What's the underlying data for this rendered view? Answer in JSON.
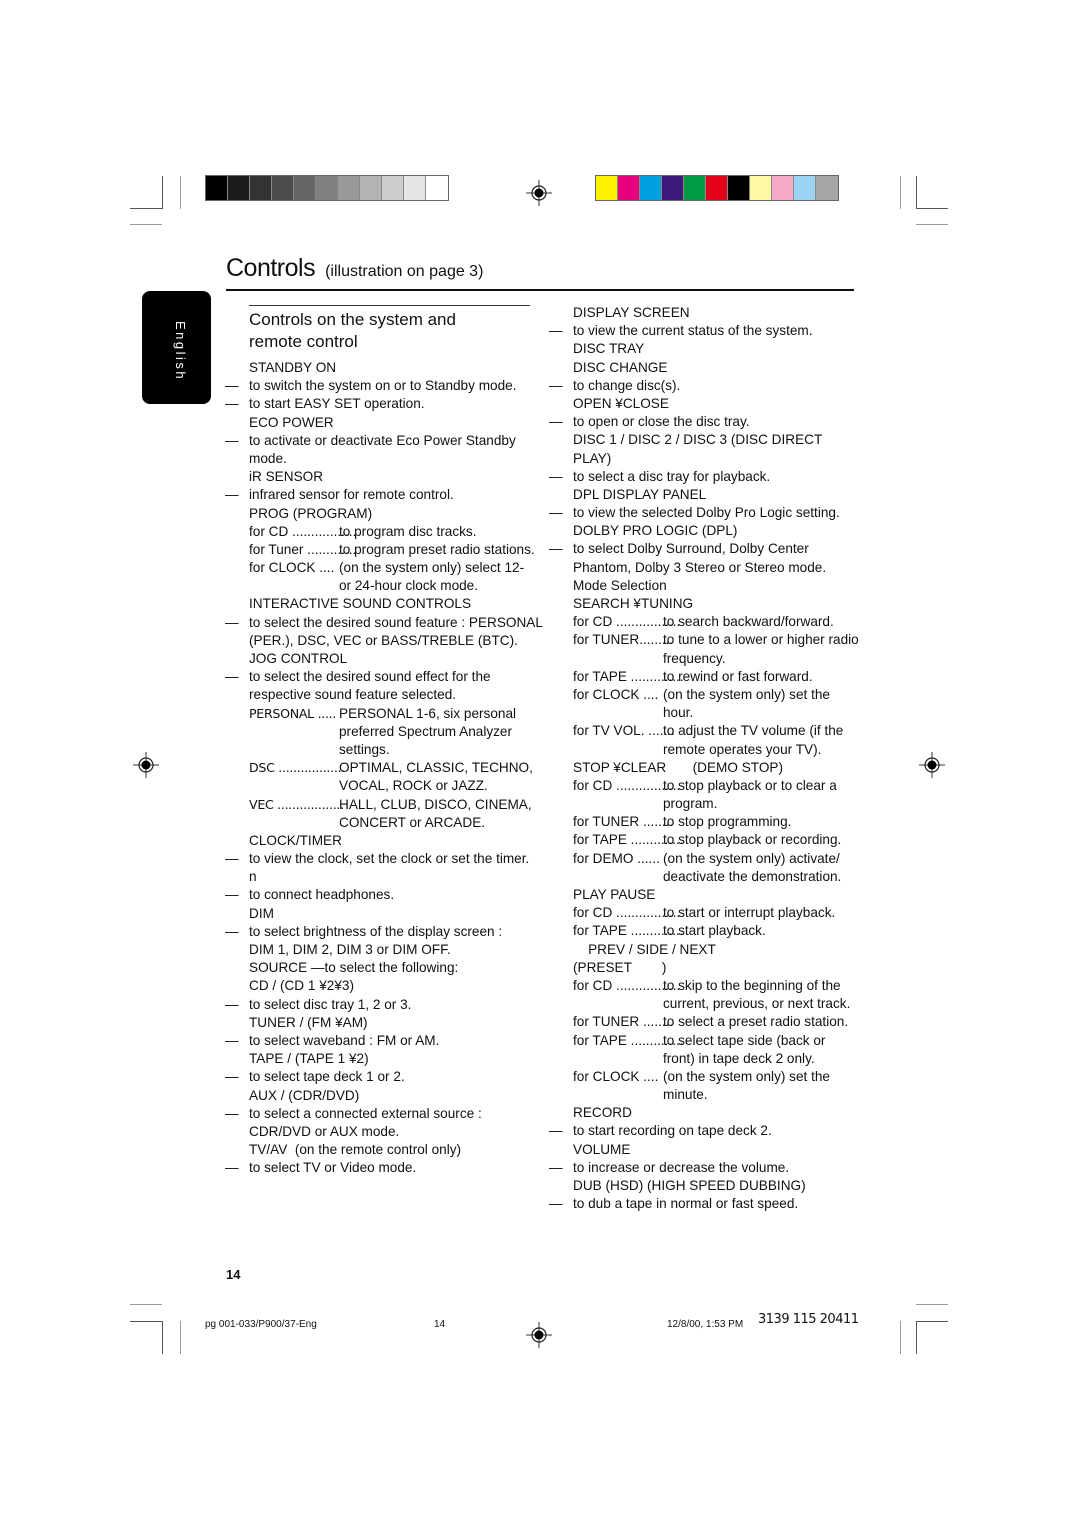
{
  "print_marks": {
    "gray_swatches": [
      "#000000",
      "#1c1c1c",
      "#333333",
      "#4d4d4d",
      "#666666",
      "#808080",
      "#999999",
      "#b3b3b3",
      "#cccccc",
      "#e6e6e6",
      "#ffffff"
    ],
    "color_swatches": [
      "#fff200",
      "#e6007e",
      "#00a0e3",
      "#3d1a7a",
      "#009a44",
      "#e2001a",
      "#000000",
      "#fff9a6",
      "#f5a9c8",
      "#9cd3f3",
      "#a6a6a6"
    ]
  },
  "header": {
    "title": "Controls",
    "subtitle": "(illustration on page 3)"
  },
  "language_tab": "English",
  "section": {
    "title_line1": "Controls on the system and",
    "title_line2": "remote control"
  },
  "left_column": [
    {
      "type": "heading",
      "text": "STANDBY ON"
    },
    {
      "type": "dash",
      "text": "to switch the system on or to Standby mode."
    },
    {
      "type": "dash",
      "text": "to start EASY SET operation."
    },
    {
      "type": "heading",
      "text": "ECO POWER"
    },
    {
      "type": "dash",
      "text": "to activate or deactivate Eco Power Standby"
    },
    {
      "type": "text",
      "text": "mode."
    },
    {
      "type": "heading",
      "text": "iR SENSOR"
    },
    {
      "type": "dash",
      "text": "infrared sensor for remote control."
    },
    {
      "type": "heading",
      "text": "PROG (PROGRAM)"
    },
    {
      "type": "item",
      "label": "for CD .................",
      "desc": "to program disc tracks."
    },
    {
      "type": "item",
      "label": "for Tuner .............",
      "desc": "to program preset radio stations."
    },
    {
      "type": "item",
      "label": "for CLOCK ....",
      "desc": "(on the system only) select 12-"
    },
    {
      "type": "cont",
      "text": "or 24-hour clock mode."
    },
    {
      "type": "heading",
      "text": "INTERACTIVE SOUND CONTROLS"
    },
    {
      "type": "dash",
      "text": "to select the desired sound feature : PERSONAL"
    },
    {
      "type": "text",
      "text": "(PER.), DSC, VEC or BASS/TREBLE (BTC)."
    },
    {
      "type": "heading",
      "text": "JOG CONTROL"
    },
    {
      "type": "dash",
      "text": "to select the desired sound effect for the"
    },
    {
      "type": "text",
      "text": "respective sound feature selected."
    },
    {
      "type": "item2",
      "label": "PERSONAL .....",
      "desc": "PERSONAL 1-6, six personal"
    },
    {
      "type": "cont",
      "text": "preferred Spectrum Analyzer"
    },
    {
      "type": "cont",
      "text": "settings."
    },
    {
      "type": "item2",
      "label": "DSC ..................",
      "desc": "OPTIMAL, CLASSIC, TECHNO,"
    },
    {
      "type": "cont",
      "text": "VOCAL, ROCK or JAZZ."
    },
    {
      "type": "item2",
      "label": "VEC ..................",
      "desc": "HALL, CLUB, DISCO, CINEMA,"
    },
    {
      "type": "cont",
      "text": "CONCERT or ARCADE."
    },
    {
      "type": "heading",
      "text": "CLOCK/TIMER"
    },
    {
      "type": "dash",
      "text": "to view the clock, set the clock or set the timer."
    },
    {
      "type": "text",
      "text": "n"
    },
    {
      "type": "dash",
      "text": "to connect headphones."
    },
    {
      "type": "heading",
      "text": "DIM"
    },
    {
      "type": "dash",
      "text": "to select brightness of the display screen :"
    },
    {
      "type": "text",
      "text": "DIM 1, DIM 2, DIM 3 or DIM OFF."
    },
    {
      "type": "text",
      "text": "SOURCE —to select the following:"
    },
    {
      "type": "text",
      "text": "CD / (CD 1 ¥2¥3)"
    },
    {
      "type": "dash",
      "text": "to select disc tray 1, 2 or 3."
    },
    {
      "type": "heading",
      "text": "TUNER / (FM ¥AM)"
    },
    {
      "type": "dash",
      "text": "to select waveband : FM or AM."
    },
    {
      "type": "heading",
      "text": "TAPE / (TAPE 1 ¥2)"
    },
    {
      "type": "dash",
      "text": "to select tape deck 1 or 2."
    },
    {
      "type": "heading",
      "text": "AUX / (CDR/DVD)"
    },
    {
      "type": "dash",
      "text": "to select a connected external source :"
    },
    {
      "type": "text",
      "text": "CDR/DVD or AUX mode."
    },
    {
      "type": "heading",
      "text": "TV/AV  (on the remote control only)"
    },
    {
      "type": "dash",
      "text": "to select TV or Video mode."
    }
  ],
  "right_column": [
    {
      "type": "heading",
      "text": "DISPLAY SCREEN"
    },
    {
      "type": "dash",
      "text": "to view the current status of the system."
    },
    {
      "type": "heading",
      "text": "DISC TRAY"
    },
    {
      "type": "heading",
      "text": "DISC CHANGE"
    },
    {
      "type": "dash",
      "text": "to change disc(s)."
    },
    {
      "type": "heading",
      "text": "OPEN ¥CLOSE"
    },
    {
      "type": "dash",
      "text": "to open or close the disc tray."
    },
    {
      "type": "heading",
      "text": "DISC 1 / DISC 2 / DISC 3 (DISC DIRECT"
    },
    {
      "type": "text",
      "text": "PLAY)"
    },
    {
      "type": "dash",
      "text": "to select a disc tray for playback."
    },
    {
      "type": "heading",
      "text": "DPL DISPLAY PANEL"
    },
    {
      "type": "dash",
      "text": "to view the selected Dolby Pro Logic setting."
    },
    {
      "type": "heading",
      "text": "DOLBY PRO LOGIC (DPL)"
    },
    {
      "type": "dash",
      "text": "to select Dolby Surround, Dolby Center"
    },
    {
      "type": "text",
      "text": "Phantom, Dolby 3 Stereo or Stereo mode."
    },
    {
      "type": "text",
      "text": "Mode Selection"
    },
    {
      "type": "heading",
      "text": "SEARCH ¥TUNING"
    },
    {
      "type": "item",
      "label": "for CD .................",
      "desc": "to search backward/forward."
    },
    {
      "type": "item",
      "label": "for TUNER.........",
      "desc": "to tune to a lower or higher radio"
    },
    {
      "type": "cont",
      "text": "frequency."
    },
    {
      "type": "item",
      "label": "for TAPE ..............",
      "desc": "to rewind or fast forward."
    },
    {
      "type": "item",
      "label": "for CLOCK ....",
      "desc": "(on the system only) set the"
    },
    {
      "type": "cont",
      "text": "hour."
    },
    {
      "type": "item",
      "label": "for TV VOL. .......",
      "desc": "to adjust the TV volume (if the"
    },
    {
      "type": "cont",
      "text": "remote operates your TV)."
    },
    {
      "type": "heading",
      "text": "STOP ¥CLEAR       (DEMO STOP)"
    },
    {
      "type": "item",
      "label": "for CD .................",
      "desc": "to stop playback or to clear a"
    },
    {
      "type": "cont",
      "text": "program."
    },
    {
      "type": "item",
      "label": "for TUNER ........",
      "desc": "to stop programming."
    },
    {
      "type": "item",
      "label": "for TAPE ..............",
      "desc": "to stop playback or recording."
    },
    {
      "type": "item",
      "label": "for DEMO ......",
      "desc": "(on the system only) activate/"
    },
    {
      "type": "cont",
      "text": "deactivate the demonstration."
    },
    {
      "type": "heading",
      "text": "PLAY PAUSE"
    },
    {
      "type": "item",
      "label": "for CD .................",
      "desc": "to start or interrupt playback."
    },
    {
      "type": "item",
      "label": "for TAPE ..............",
      "desc": "to start playback."
    },
    {
      "type": "heading",
      "text": "    PREV / SIDE / NEXT"
    },
    {
      "type": "heading",
      "text": "(PRESET        )"
    },
    {
      "type": "item",
      "label": "for CD .................",
      "desc": "to skip to the beginning of the"
    },
    {
      "type": "cont",
      "text": "current, previous, or next track."
    },
    {
      "type": "item",
      "label": "for TUNER ........",
      "desc": "to select a preset radio station."
    },
    {
      "type": "item",
      "label": "for TAPE ..............",
      "desc": "to select tape side (back or"
    },
    {
      "type": "cont",
      "text": "front) in tape deck 2 only."
    },
    {
      "type": "item",
      "label": "for CLOCK ....",
      "desc": "(on the system only) set the"
    },
    {
      "type": "cont",
      "text": "minute."
    },
    {
      "type": "heading",
      "text": "RECORD"
    },
    {
      "type": "dash",
      "text": "to start recording on tape deck 2."
    },
    {
      "type": "heading",
      "text": "VOLUME"
    },
    {
      "type": "dash",
      "text": "to increase or decrease the volume."
    },
    {
      "type": "heading",
      "text": "DUB (HSD) (HIGH SPEED DUBBING)"
    },
    {
      "type": "dash",
      "text": "to dub a tape in normal or fast speed."
    }
  ],
  "page_number": "14",
  "footer": {
    "file": "pg 001-033/P900/37-Eng",
    "page": "14",
    "datetime": "12/8/00, 1:53 PM",
    "code": "3139 115 20411"
  }
}
